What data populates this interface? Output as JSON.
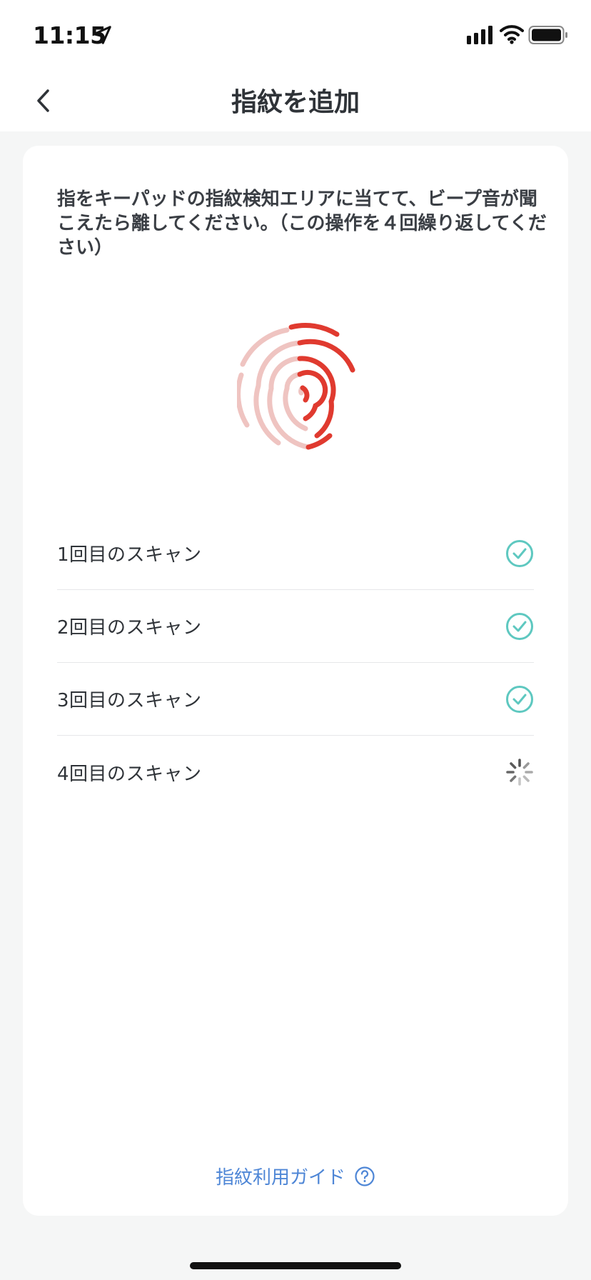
{
  "status_bar": {
    "time": "11:15",
    "icons": [
      "location-arrow-icon",
      "cellular-signal-icon",
      "wifi-icon",
      "battery-icon"
    ]
  },
  "nav": {
    "back_icon": "chevron-left-icon",
    "title": "指紋を追加"
  },
  "card": {
    "instruction": "指をキーパッドの指紋検知エリアに当てて、ビープ音が聞こえたら離してください。（この操作を４回繰り返してください）",
    "fingerprint": {
      "icon": "fingerprint-icon",
      "progress": 0.75,
      "colors": {
        "active": "#e03a2f",
        "inactive": "#efc4c1"
      }
    },
    "scans": [
      {
        "label": "1回目のスキャン",
        "status": "complete"
      },
      {
        "label": "2回目のスキャン",
        "status": "complete"
      },
      {
        "label": "3回目のスキャン",
        "status": "complete"
      },
      {
        "label": "4回目のスキャン",
        "status": "in-progress"
      }
    ],
    "guide_link": "指紋利用ガイド"
  },
  "colors": {
    "accent_check": "#5ec8c0",
    "link": "#4e86d6",
    "fingerprint_red": "#e03a2f",
    "fingerprint_light": "#efc4c1"
  }
}
